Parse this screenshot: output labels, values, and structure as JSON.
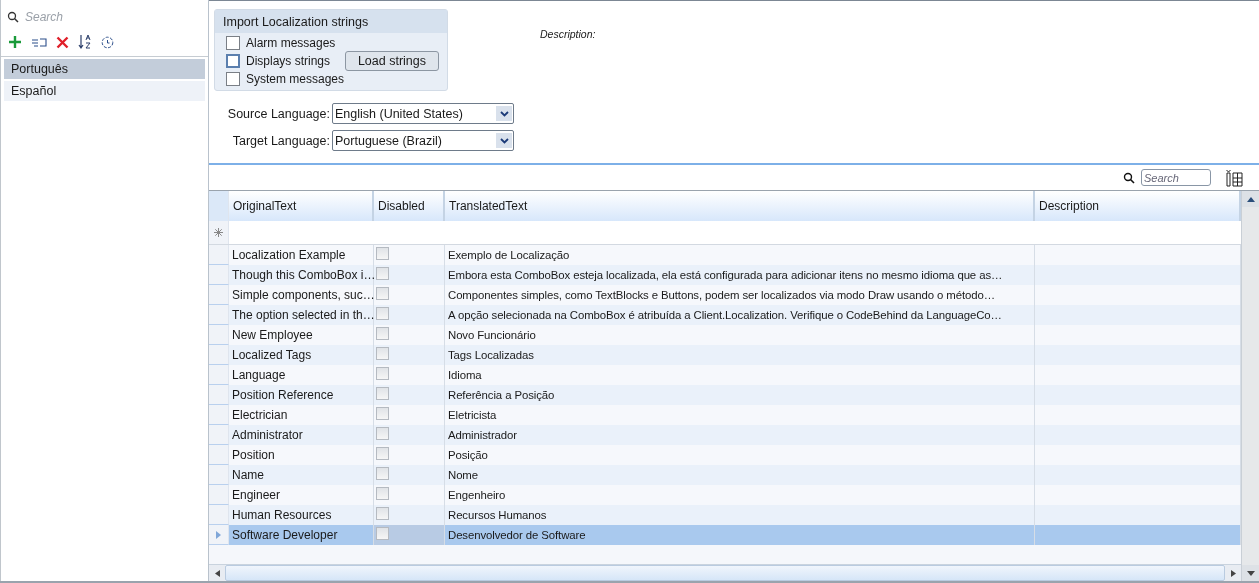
{
  "sidebar": {
    "search": {
      "placeholder": "Search"
    },
    "toolbar": [
      {
        "kind": "add"
      },
      {
        "kind": "rename"
      },
      {
        "kind": "delete"
      },
      {
        "kind": "sort"
      },
      {
        "kind": "clock"
      }
    ],
    "items": [
      {
        "label": "Português",
        "selected": true
      },
      {
        "label": "Español",
        "selected": false
      }
    ]
  },
  "import": {
    "title": "Import Localization strings",
    "options": [
      {
        "label": "Alarm messages",
        "checked": false,
        "focused": false
      },
      {
        "label": "Displays strings",
        "checked": false,
        "focused": true
      },
      {
        "label": "System messages",
        "checked": false,
        "focused": false
      }
    ],
    "button": "Load strings"
  },
  "description_label": "Description:",
  "source_language": {
    "label": "Source Language:",
    "value": "English (United States)"
  },
  "target_language": {
    "label": "Target Language:",
    "value": "Portuguese (Brazil)"
  },
  "grid_search": {
    "placeholder": "Search"
  },
  "table": {
    "columns": [
      "OriginalText",
      "Disabled",
      "TranslatedText",
      "Description"
    ],
    "rows": [
      {
        "original": "Localization Example",
        "disabled": false,
        "translated": "Exemplo de Localização",
        "selected": false
      },
      {
        "original": "Though this ComboBox i…",
        "disabled": false,
        "translated": "Embora esta ComboBox esteja localizada, ela está configurada para adicionar itens no mesmo idioma que as…",
        "selected": false
      },
      {
        "original": "Simple components, suc…",
        "disabled": false,
        "translated": "Componentes simples, como TextBlocks e Buttons, podem ser localizados via modo Draw usando o método…",
        "selected": false
      },
      {
        "original": "The option selected in th…",
        "disabled": false,
        "translated": "A opção selecionada na ComboBox é atribuída a Client.Localization. Verifique o CodeBehind da LanguageCo…",
        "selected": false
      },
      {
        "original": "New Employee",
        "disabled": false,
        "translated": "Novo Funcionário",
        "selected": false
      },
      {
        "original": "Localized Tags",
        "disabled": false,
        "translated": "Tags Localizadas",
        "selected": false
      },
      {
        "original": "Language",
        "disabled": false,
        "translated": "Idioma",
        "selected": false
      },
      {
        "original": "Position Reference",
        "disabled": false,
        "translated": "Referência a Posição",
        "selected": false
      },
      {
        "original": "Electrician",
        "disabled": false,
        "translated": "Eletricista",
        "selected": false
      },
      {
        "original": "Administrator",
        "disabled": false,
        "translated": "Administrador",
        "selected": false
      },
      {
        "original": "Position",
        "disabled": false,
        "translated": "Posição",
        "selected": false
      },
      {
        "original": "Name",
        "disabled": false,
        "translated": "Nome",
        "selected": false
      },
      {
        "original": "Engineer",
        "disabled": false,
        "translated": "Engenheiro",
        "selected": false
      },
      {
        "original": "Human Resources",
        "disabled": false,
        "translated": "Recursos Humanos",
        "selected": false
      },
      {
        "original": "Software Developer",
        "disabled": false,
        "translated": "Desenvolvedor de Software",
        "selected": true
      }
    ]
  }
}
